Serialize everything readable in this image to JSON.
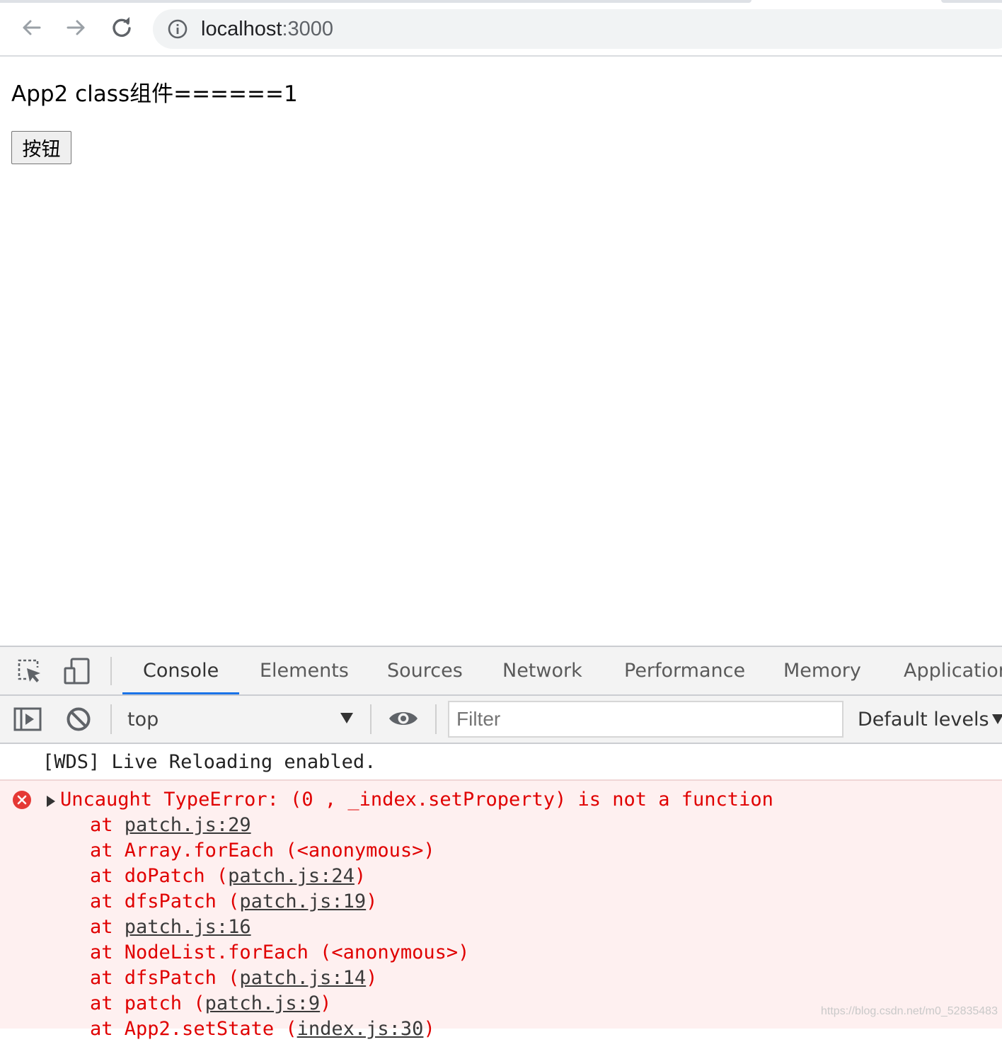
{
  "browser": {
    "url_host": "localhost",
    "url_port": ":3000",
    "icons": [
      "back-arrow-icon",
      "forward-arrow-icon",
      "reload-icon",
      "info-icon"
    ]
  },
  "page": {
    "heading": "App2 class组件======1",
    "button_label": "按钮"
  },
  "devtools": {
    "tabs": [
      {
        "label": "Console",
        "active": true
      },
      {
        "label": "Elements"
      },
      {
        "label": "Sources"
      },
      {
        "label": "Network"
      },
      {
        "label": "Performance"
      },
      {
        "label": "Memory"
      },
      {
        "label": "Application"
      }
    ],
    "context": "top",
    "filter_placeholder": "Filter",
    "levels": "Default levels"
  },
  "console": {
    "log": "[WDS] Live Reloading enabled.",
    "error": {
      "message": "Uncaught TypeError: (0 , _index.setProperty) is not a function",
      "stack": [
        {
          "prefix": "at ",
          "fn": "",
          "loc": "patch.js:29",
          "open": "",
          "close": ""
        },
        {
          "prefix": "at ",
          "fn": "Array.forEach (<anonymous>)",
          "loc": "",
          "open": "",
          "close": ""
        },
        {
          "prefix": "at ",
          "fn": "doPatch ",
          "loc": "patch.js:24",
          "open": "(",
          "close": ")"
        },
        {
          "prefix": "at ",
          "fn": "dfsPatch ",
          "loc": "patch.js:19",
          "open": "(",
          "close": ")"
        },
        {
          "prefix": "at ",
          "fn": "",
          "loc": "patch.js:16",
          "open": "",
          "close": ""
        },
        {
          "prefix": "at ",
          "fn": "NodeList.forEach (<anonymous>)",
          "loc": "",
          "open": "",
          "close": ""
        },
        {
          "prefix": "at ",
          "fn": "dfsPatch ",
          "loc": "patch.js:14",
          "open": "(",
          "close": ")"
        },
        {
          "prefix": "at ",
          "fn": "patch ",
          "loc": "patch.js:9",
          "open": "(",
          "close": ")"
        },
        {
          "prefix": "at ",
          "fn": "App2.setState ",
          "loc": "index.js:30",
          "open": "(",
          "close": ")"
        }
      ]
    }
  },
  "watermark": "https://blog.csdn.net/m0_52835483",
  "colors": {
    "error_text": "#e00000",
    "error_bg": "#fef0f0",
    "active_tab_underline": "#1a73e8"
  }
}
